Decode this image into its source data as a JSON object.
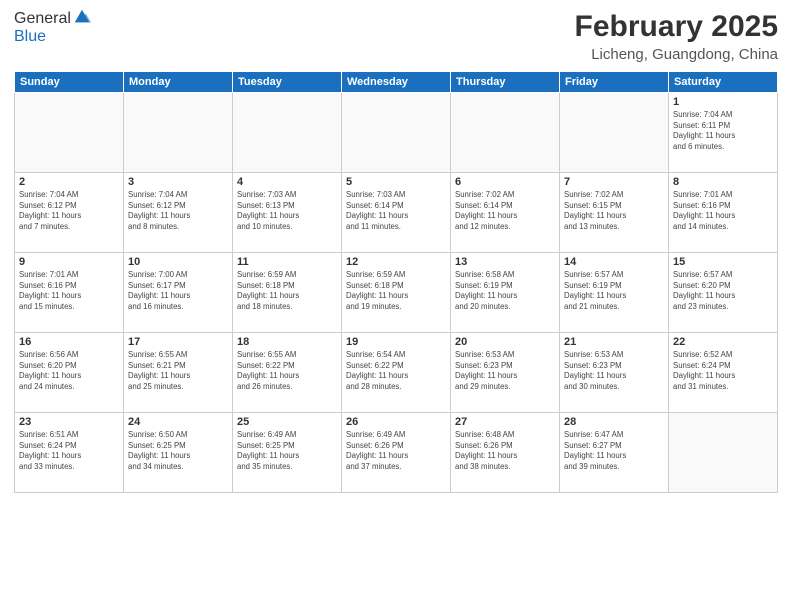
{
  "header": {
    "logo_general": "General",
    "logo_blue": "Blue",
    "month_title": "February 2025",
    "location": "Licheng, Guangdong, China"
  },
  "weekdays": [
    "Sunday",
    "Monday",
    "Tuesday",
    "Wednesday",
    "Thursday",
    "Friday",
    "Saturday"
  ],
  "weeks": [
    [
      {
        "day": "",
        "info": ""
      },
      {
        "day": "",
        "info": ""
      },
      {
        "day": "",
        "info": ""
      },
      {
        "day": "",
        "info": ""
      },
      {
        "day": "",
        "info": ""
      },
      {
        "day": "",
        "info": ""
      },
      {
        "day": "1",
        "info": "Sunrise: 7:04 AM\nSunset: 6:11 PM\nDaylight: 11 hours\nand 6 minutes."
      }
    ],
    [
      {
        "day": "2",
        "info": "Sunrise: 7:04 AM\nSunset: 6:12 PM\nDaylight: 11 hours\nand 7 minutes."
      },
      {
        "day": "3",
        "info": "Sunrise: 7:04 AM\nSunset: 6:12 PM\nDaylight: 11 hours\nand 8 minutes."
      },
      {
        "day": "4",
        "info": "Sunrise: 7:03 AM\nSunset: 6:13 PM\nDaylight: 11 hours\nand 10 minutes."
      },
      {
        "day": "5",
        "info": "Sunrise: 7:03 AM\nSunset: 6:14 PM\nDaylight: 11 hours\nand 11 minutes."
      },
      {
        "day": "6",
        "info": "Sunrise: 7:02 AM\nSunset: 6:14 PM\nDaylight: 11 hours\nand 12 minutes."
      },
      {
        "day": "7",
        "info": "Sunrise: 7:02 AM\nSunset: 6:15 PM\nDaylight: 11 hours\nand 13 minutes."
      },
      {
        "day": "8",
        "info": "Sunrise: 7:01 AM\nSunset: 6:16 PM\nDaylight: 11 hours\nand 14 minutes."
      }
    ],
    [
      {
        "day": "9",
        "info": "Sunrise: 7:01 AM\nSunset: 6:16 PM\nDaylight: 11 hours\nand 15 minutes."
      },
      {
        "day": "10",
        "info": "Sunrise: 7:00 AM\nSunset: 6:17 PM\nDaylight: 11 hours\nand 16 minutes."
      },
      {
        "day": "11",
        "info": "Sunrise: 6:59 AM\nSunset: 6:18 PM\nDaylight: 11 hours\nand 18 minutes."
      },
      {
        "day": "12",
        "info": "Sunrise: 6:59 AM\nSunset: 6:18 PM\nDaylight: 11 hours\nand 19 minutes."
      },
      {
        "day": "13",
        "info": "Sunrise: 6:58 AM\nSunset: 6:19 PM\nDaylight: 11 hours\nand 20 minutes."
      },
      {
        "day": "14",
        "info": "Sunrise: 6:57 AM\nSunset: 6:19 PM\nDaylight: 11 hours\nand 21 minutes."
      },
      {
        "day": "15",
        "info": "Sunrise: 6:57 AM\nSunset: 6:20 PM\nDaylight: 11 hours\nand 23 minutes."
      }
    ],
    [
      {
        "day": "16",
        "info": "Sunrise: 6:56 AM\nSunset: 6:20 PM\nDaylight: 11 hours\nand 24 minutes."
      },
      {
        "day": "17",
        "info": "Sunrise: 6:55 AM\nSunset: 6:21 PM\nDaylight: 11 hours\nand 25 minutes."
      },
      {
        "day": "18",
        "info": "Sunrise: 6:55 AM\nSunset: 6:22 PM\nDaylight: 11 hours\nand 26 minutes."
      },
      {
        "day": "19",
        "info": "Sunrise: 6:54 AM\nSunset: 6:22 PM\nDaylight: 11 hours\nand 28 minutes."
      },
      {
        "day": "20",
        "info": "Sunrise: 6:53 AM\nSunset: 6:23 PM\nDaylight: 11 hours\nand 29 minutes."
      },
      {
        "day": "21",
        "info": "Sunrise: 6:53 AM\nSunset: 6:23 PM\nDaylight: 11 hours\nand 30 minutes."
      },
      {
        "day": "22",
        "info": "Sunrise: 6:52 AM\nSunset: 6:24 PM\nDaylight: 11 hours\nand 31 minutes."
      }
    ],
    [
      {
        "day": "23",
        "info": "Sunrise: 6:51 AM\nSunset: 6:24 PM\nDaylight: 11 hours\nand 33 minutes."
      },
      {
        "day": "24",
        "info": "Sunrise: 6:50 AM\nSunset: 6:25 PM\nDaylight: 11 hours\nand 34 minutes."
      },
      {
        "day": "25",
        "info": "Sunrise: 6:49 AM\nSunset: 6:25 PM\nDaylight: 11 hours\nand 35 minutes."
      },
      {
        "day": "26",
        "info": "Sunrise: 6:49 AM\nSunset: 6:26 PM\nDaylight: 11 hours\nand 37 minutes."
      },
      {
        "day": "27",
        "info": "Sunrise: 6:48 AM\nSunset: 6:26 PM\nDaylight: 11 hours\nand 38 minutes."
      },
      {
        "day": "28",
        "info": "Sunrise: 6:47 AM\nSunset: 6:27 PM\nDaylight: 11 hours\nand 39 minutes."
      },
      {
        "day": "",
        "info": ""
      }
    ]
  ]
}
